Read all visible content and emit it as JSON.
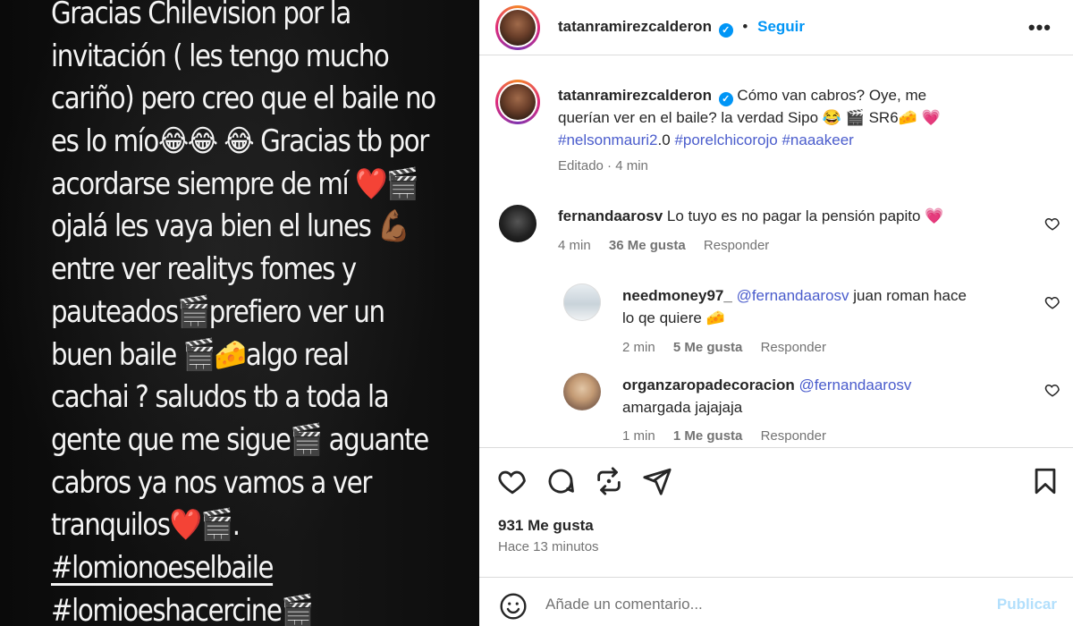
{
  "story": {
    "lines": [
      "Gracias Chilevision por la",
      "invitación ( les tengo mucho",
      "cariño) pero creo que el baile no",
      "es lo mío😂😂 😂 Gracias tb por",
      "acordarse siempre de mí ❤️🎬",
      "ojalá les vaya bien el lunes 💪🏾",
      "entre ver realitys fomes y",
      "pauteados🎬prefiero ver un",
      "buen baile 🎬🧀algo real",
      "cachai ?  saludos tb a toda la",
      "gente que me sigue🎬 aguante",
      "cabros ya nos vamos a ver",
      "tranquilos❤️🎬."
    ],
    "hashtags": [
      "#lomionoeselbaile",
      "#lomioeshacercine🎬"
    ]
  },
  "post": {
    "username": "tatanramirezcalderon",
    "follow_label": "Seguir",
    "more_label": "•••",
    "caption": {
      "username": "tatanramirezcalderon",
      "text": "Cómo van cabros? Oye, me querían ver en el baile? la verdad Sipo 😂 🎬 SR6🧀 💗",
      "tag1": "#nelsonmauri2",
      "tag1_suffix": ".0",
      "tag2": "#porelchicorojo",
      "tag3": "#naaakeer",
      "meta": "Editado · 4 min"
    },
    "comments": [
      {
        "username": "fernandaarosv",
        "text": "Lo tuyo es no pagar la pensión papito 💗",
        "time": "4 min",
        "likes": "36 Me gusta",
        "reply": "Responder"
      },
      {
        "username": "needmoney97_",
        "mention": "@fernandaarosv",
        "text": "juan roman hace lo qe quiere 🧀",
        "time": "2 min",
        "likes": "5 Me gusta",
        "reply": "Responder"
      },
      {
        "username": "organzaropadecoracion",
        "mention": "@fernandaarosv",
        "text": "amargada jajajaja",
        "time": "1 min",
        "likes": "1 Me gusta",
        "reply": "Responder"
      }
    ],
    "likes_label": "931 Me gusta",
    "time_ago": "Hace 13 minutos",
    "comment_placeholder": "Añade un comentario...",
    "publish_label": "Publicar"
  },
  "icons": {
    "verified": "verified-badge-icon",
    "like": "heart-icon",
    "comment": "comment-bubble-icon",
    "share": "repost-icon",
    "send": "paper-plane-icon",
    "save": "bookmark-icon",
    "emoji": "smiley-icon"
  },
  "colors": {
    "link_blue": "#0095f6",
    "hashtag": "#4a5ccc",
    "publish_disabled": "#b2dffc",
    "muted": "#737373"
  }
}
